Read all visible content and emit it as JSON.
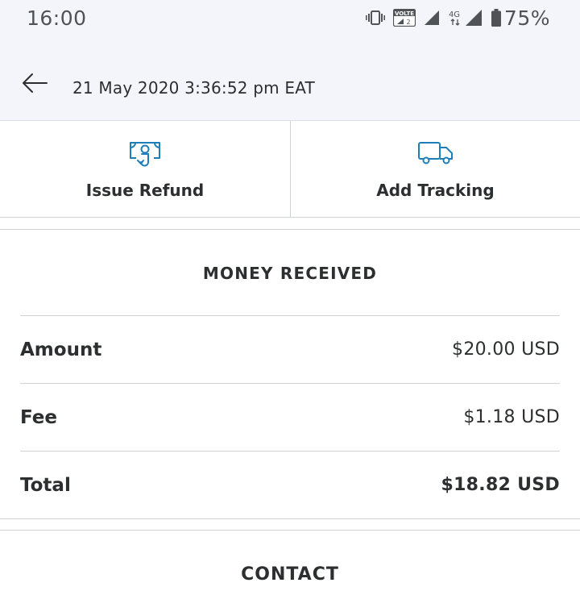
{
  "status_bar": {
    "time": "16:00",
    "volte_label": "VOLTE",
    "sim_label": "2",
    "network_label": "4G",
    "battery_percent": "75%",
    "icons": [
      "vibrate-icon",
      "volte-icon",
      "signal-icon",
      "signal-4g-icon",
      "battery-icon"
    ]
  },
  "app_bar": {
    "back_icon": "arrow-left-icon",
    "title": "21 May 2020 3:36:52 pm EAT"
  },
  "actions": [
    {
      "icon": "refund-icon",
      "label": "Issue Refund"
    },
    {
      "icon": "truck-icon",
      "label": "Add Tracking"
    }
  ],
  "money_received": {
    "heading": "MONEY RECEIVED",
    "rows": [
      {
        "label": "Amount",
        "value": "$20.00 USD"
      },
      {
        "label": "Fee",
        "value": "$1.18 USD"
      },
      {
        "label": "Total",
        "value": "$18.82 USD"
      }
    ]
  },
  "contact": {
    "heading": "CONTACT"
  },
  "colors": {
    "accent": "#1e7fb8",
    "text": "#2c2e2f",
    "header_bg": "#f3f5fa",
    "divider": "#d0d3d6"
  }
}
